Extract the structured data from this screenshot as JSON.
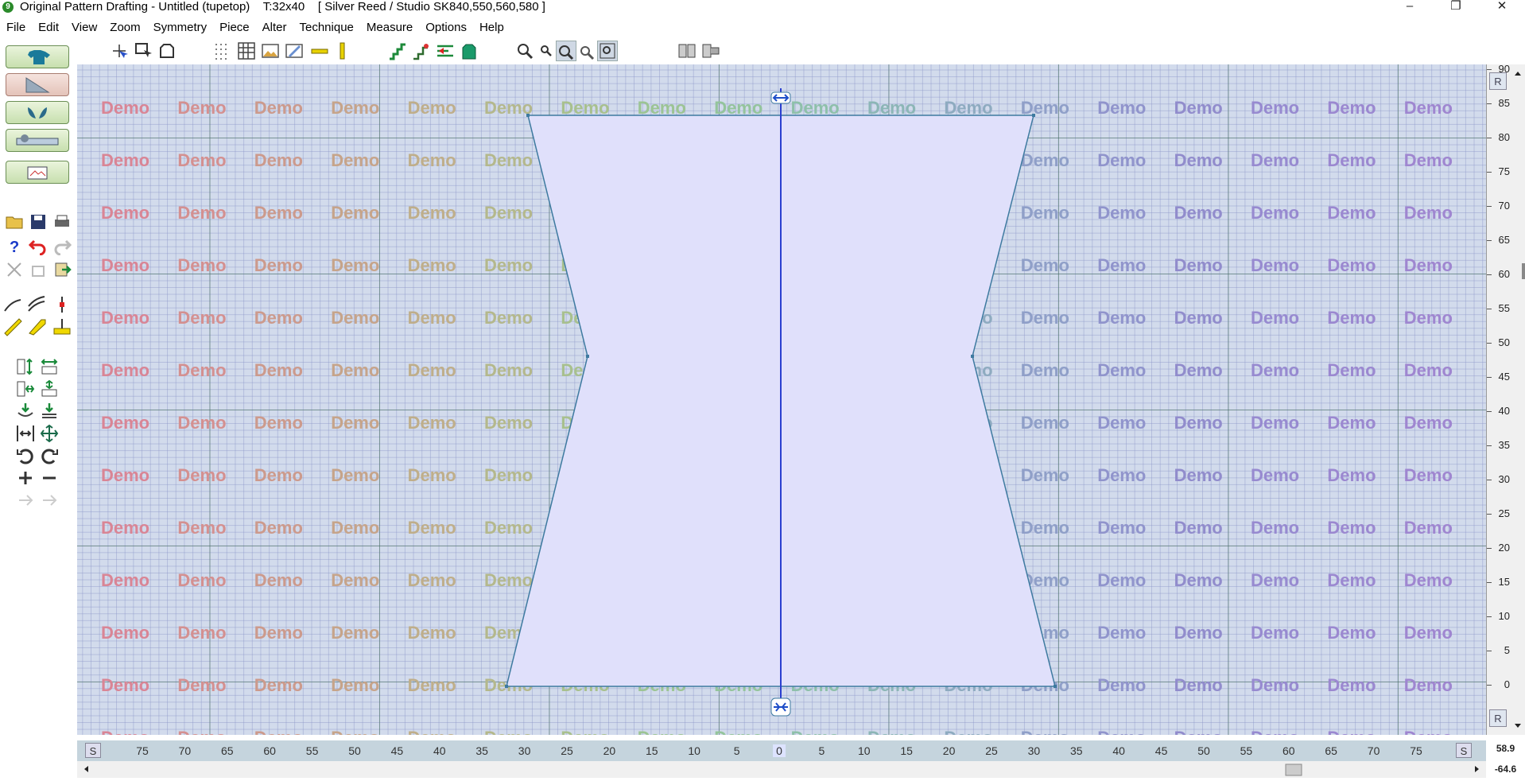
{
  "window": {
    "title": "Original Pattern Drafting - Untitled (tupetop)    T:32x40    [ Silver Reed / Studio SK840,550,560,580 ]",
    "app_icon": "9",
    "minimize": "–",
    "maximize": "❐",
    "close": "✕"
  },
  "menu": [
    "File",
    "Edit",
    "View",
    "Zoom",
    "Symmetry",
    "Piece",
    "Alter",
    "Technique",
    "Measure",
    "Options",
    "Help"
  ],
  "toolbar_icons": [
    "select-pointer-icon",
    "select-box-icon",
    "piece-outline-icon",
    "dot-grid-icon",
    "grid-icon",
    "landscape-image-icon",
    "edit-image-icon",
    "horizontal-ruler-icon",
    "vertical-ruler-icon",
    "shaping-steps-icon",
    "shaping-red-steps-icon",
    "shaping-arrow-icon",
    "knit-garment-icon",
    "zoom-in-icon",
    "zoom-out-icon",
    "zoom-window-icon",
    "zoom-fit-icon",
    "zoom-page-icon",
    "view-side-by-side-icon",
    "view-arrow-icon"
  ],
  "left_panel_icons": [
    "garment-top-icon",
    "slope-icon",
    "leaf-pair-icon",
    "knit-machine-icon",
    "chart-image-icon",
    "open-folder-icon",
    "save-disk-icon",
    "print-icon",
    "help-question-icon",
    "undo-icon",
    "redo-icon",
    "cut-scissors-icon",
    "copy-icon",
    "paste-icon",
    "curve-icon",
    "multi-curve-icon",
    "point-marker-icon",
    "ruler-measure-icon",
    "measure-tape-icon",
    "level-measure-icon",
    "stretch-vertical-icon",
    "stretch-horizontal-icon",
    "move-vertical-icon",
    "move-horizontal-icon",
    "down-arrow-icon",
    "down-stack-icon",
    "shrink-icon",
    "expand-icon",
    "rotate-ccw-icon",
    "rotate-cw-icon",
    "plus-icon",
    "minus-icon",
    "step-back-icon",
    "step-forward-icon"
  ],
  "watermark_text": "Demo",
  "watermark_colors": [
    "#d98595",
    "#d49090",
    "#cc9a8c",
    "#c6a48a",
    "#bfae8a",
    "#b4b88c",
    "#a8c08e",
    "#9cc494",
    "#94c49c",
    "#8ec0aa",
    "#8cb6b6",
    "#8eabc0",
    "#8f9fc8",
    "#9094cc",
    "#918ccc",
    "#978ad0",
    "#9b88d0",
    "#9f86d0"
  ],
  "piece": {
    "fill": "#e0e0fb",
    "outline": "#3e7aa0",
    "center_line": "#2a3fd0",
    "top_handle_icon": "horizontal-resize-handle-icon",
    "bottom_handle_icon": "vertical-resize-handle-icon"
  },
  "right_ruler": {
    "labels": [
      "90",
      "85",
      "80",
      "75",
      "70",
      "65",
      "60",
      "55",
      "50",
      "45",
      "40",
      "35",
      "30",
      "25",
      "20",
      "15",
      "10",
      "5",
      "0"
    ],
    "top_button": "R",
    "bottom_button": "R"
  },
  "bottom_ruler": {
    "labels": [
      "75",
      "70",
      "65",
      "60",
      "55",
      "50",
      "45",
      "40",
      "35",
      "30",
      "25",
      "20",
      "15",
      "10",
      "5",
      "0",
      "5",
      "10",
      "15",
      "20",
      "25",
      "30",
      "35",
      "40",
      "45",
      "50",
      "55",
      "60",
      "65",
      "70",
      "75"
    ],
    "left_button": "S",
    "right_button": "S"
  },
  "coordinates": {
    "x": "58.9",
    "y": "-64.6"
  }
}
